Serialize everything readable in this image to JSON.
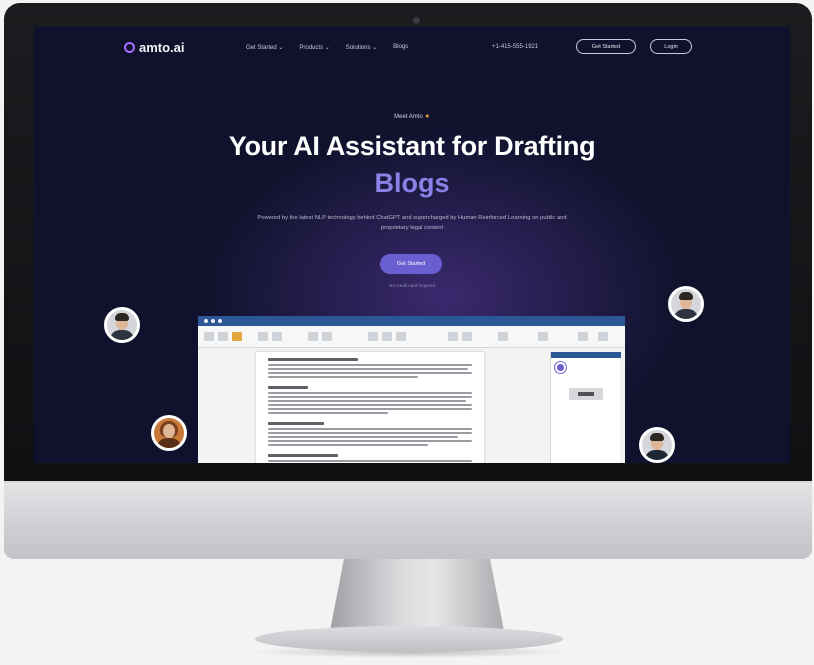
{
  "nav": {
    "logo": "amto.ai",
    "links": [
      "Get Started",
      "Products",
      "Solutions",
      "Blogs"
    ],
    "phone": "+1-415-555-1921",
    "get_started": "Get Started",
    "login": "Login"
  },
  "hero": {
    "eyebrow": "Meet Amto",
    "title": "Your AI Assistant for Drafting",
    "title_accent": "Blogs",
    "description": "Powered by the latest NLP technology behind ChatGPT and supercharged by Human Reinforced Learning on public and proprietary legal content",
    "cta": "Get Started",
    "cta_note": "No credit card required"
  },
  "colors": {
    "screen_bg": "#10122d",
    "accent": "#8a80e6",
    "cta_bg": "#6a5fd0",
    "app_titlebar": "#2b5797"
  },
  "icons": {
    "logo": "amto-logo-icon",
    "eyebrow": "star-icon"
  }
}
